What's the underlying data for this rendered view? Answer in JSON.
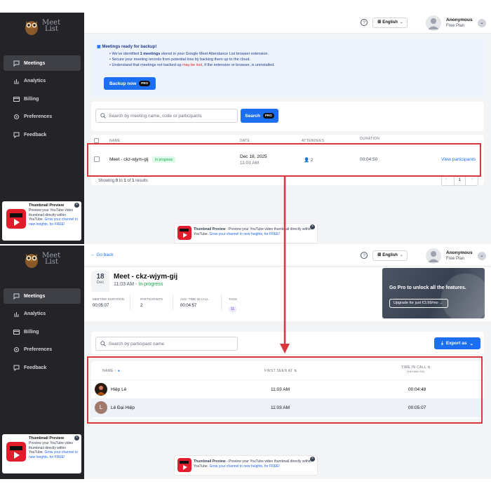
{
  "app": {
    "logo_line1": "Meet",
    "logo_line2": "List"
  },
  "sidebar": {
    "items": [
      {
        "label": "Meetings",
        "icon": "chat-icon"
      },
      {
        "label": "Analytics",
        "icon": "chart-icon"
      },
      {
        "label": "Billing",
        "icon": "card-icon"
      },
      {
        "label": "Preferences",
        "icon": "gear-icon"
      },
      {
        "label": "Feedback",
        "icon": "feedback-icon"
      }
    ]
  },
  "ad_side": {
    "title": "Thumbnail Preview",
    "body": "Preview your YouTube video thumbnail directly within YouTube.",
    "link": "Grow your channel to new heights, for FREE!"
  },
  "ad_bottom": {
    "title": "Thumbnail Preview",
    "body": " - Preview your YouTube video thumbnail directly within YouTube.",
    "link": "Grow your channel to new heights, for FREE!"
  },
  "topbar": {
    "language": "English",
    "user_name": "Anonymous",
    "user_plan": "Free Plan"
  },
  "screen1": {
    "banner": {
      "title": "Meetings ready for backup!",
      "line1_pre": "We've identified ",
      "line1_bold": "1 meetings",
      "line1_post": " stored in your Google Meet Attendance List browser extension.",
      "line2": "Secure your meeting records from potential loss by backing them up to the cloud.",
      "line3_pre": "Understand that meetings not backed up ",
      "line3_red": "may be lost",
      "line3_post": ", if the extension or browser, is uninstalled.",
      "button": "Backup now",
      "badge": "PRO"
    },
    "search": {
      "placeholder": "Search by meeting name, code or participants",
      "button": "Search",
      "badge": "PRO"
    },
    "table": {
      "columns": [
        "NAME",
        "DATE",
        "ATTENDEES",
        "DURATION"
      ],
      "row": {
        "name": "Meet - ckz-wjym-gij",
        "status": "In progress",
        "date": "Dec 18, 2025",
        "time": "11:03 AM",
        "attendees": "2",
        "duration": "00:04:50",
        "action": "View participants"
      }
    },
    "pagination": {
      "showing": "Showing ",
      "from": "0",
      "to_word": " to ",
      "to": "1",
      "of_word": " of ",
      "total": "1",
      "suffix": " results",
      "page": "1"
    }
  },
  "screen2": {
    "back": "Go back",
    "date_day": "18",
    "date_month": "Dec",
    "meeting_title": "Meet - ckz-wjym-gij",
    "meeting_time": "11:03 AM",
    "meeting_sep": " - ",
    "meeting_status": "In progress",
    "stats": [
      {
        "label": "MEETING DURATION",
        "value": "00:05:07"
      },
      {
        "label": "PARTICIPANTS",
        "value": "2"
      },
      {
        "label": "AVG. TIME IN CALL",
        "value": "00:04:57"
      },
      {
        "label": "TAGS",
        "value": "11"
      }
    ],
    "promo": {
      "title": "Go Pro to unlock all the features.",
      "button": "Upgrade for just €3.99/mo"
    },
    "search_placeholder": "Search by participant name",
    "export": "Export as",
    "table": {
      "columns": [
        "NAME",
        "FIRST SEEN AT",
        "TIME IN CALL",
        "(HH:MM:SS)"
      ],
      "rows": [
        {
          "name": "Hiệp Lê",
          "first_seen": "11:03 AM",
          "time_in_call": "00:04:48",
          "avatar": "photo"
        },
        {
          "name": "Lê Đại Hiệp",
          "first_seen": "11:03 AM",
          "time_in_call": "00:05:07",
          "avatar": "L"
        }
      ]
    }
  },
  "colors": {
    "sidebar": "#232328",
    "accent": "#1d6ff2",
    "highlight": "#d9363e",
    "success": "#16a34a"
  }
}
